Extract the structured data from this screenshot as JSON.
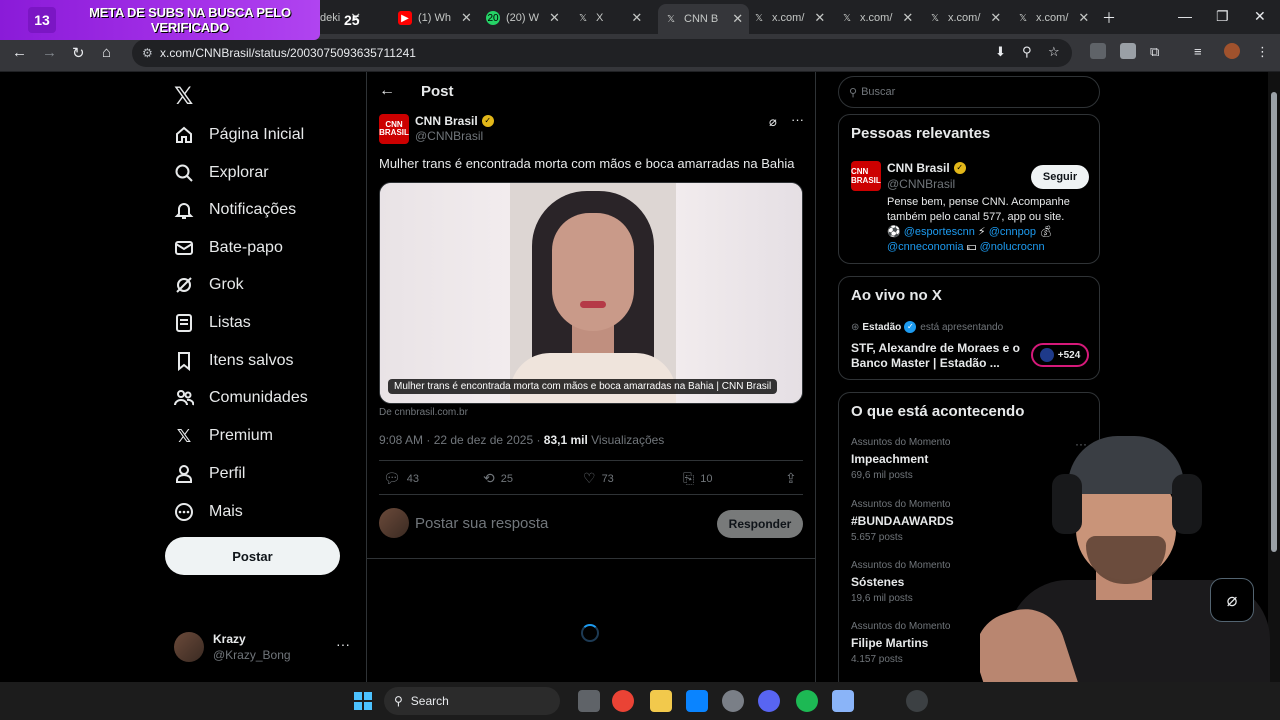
{
  "overlay": {
    "count": "13",
    "text": "META DE SUBS NA BUSCA PELO VERIFICADO",
    "badge": "25"
  },
  "tabs": [
    {
      "label": "deki"
    },
    {
      "label": "(1) Wh"
    },
    {
      "label": "(20) W"
    },
    {
      "label": "X"
    },
    {
      "label": "CNN B"
    },
    {
      "label": "x.com/"
    },
    {
      "label": "x.com/"
    },
    {
      "label": "x.com/"
    },
    {
      "label": "x.com/"
    }
  ],
  "browser": {
    "url": "x.com/CNNBrasil/status/2003075093635711241"
  },
  "sidebar": {
    "items": [
      {
        "label": "Página Inicial",
        "icon": "home-icon"
      },
      {
        "label": "Explorar",
        "icon": "search-icon"
      },
      {
        "label": "Notificações",
        "icon": "bell-icon"
      },
      {
        "label": "Bate-papo",
        "icon": "mail-icon"
      },
      {
        "label": "Grok",
        "icon": "grok-icon"
      },
      {
        "label": "Listas",
        "icon": "list-icon"
      },
      {
        "label": "Itens salvos",
        "icon": "bookmark-icon"
      },
      {
        "label": "Comunidades",
        "icon": "people-icon"
      },
      {
        "label": "Premium",
        "icon": "x-icon"
      },
      {
        "label": "Perfil",
        "icon": "person-icon"
      },
      {
        "label": "Mais",
        "icon": "more-circle-icon"
      }
    ],
    "post_label": "Postar",
    "account": {
      "name": "Krazy",
      "handle": "@Krazy_Bong"
    }
  },
  "post": {
    "header": "Post",
    "author": "CNN Brasil",
    "handle": "@CNNBrasil",
    "avatar_text": "CNN BRASIL",
    "text": "Mulher trans é encontrada morta com mãos e boca amarradas na Bahia",
    "caption": "Mulher trans é encontrada morta com mãos e boca amarradas na Bahia | CNN Brasil",
    "source": "De cnnbrasil.com.br",
    "time": "9:08 AM · 22 de dez de 2025 · ",
    "views": "83,1 mil",
    "views_label": " Visualizações",
    "replies": "43",
    "reposts": "25",
    "likes": "73",
    "bookmarks": "10",
    "reply_placeholder": "Postar sua resposta",
    "reply_label": "Responder"
  },
  "right": {
    "search_placeholder": "Buscar",
    "relevant": {
      "title": "Pessoas relevantes",
      "name": "CNN Brasil",
      "handle": "@CNNBrasil",
      "follow": "Seguir",
      "bio_text": "Pense bem, pense CNN. Acompanhe também pelo canal 577, app ou site.",
      "links": [
        "@esportescnn",
        "@cnnpop",
        "@cnneconomia",
        "@nolucrocnn"
      ]
    },
    "live": {
      "title": "Ao vivo no X",
      "host": "Estadão",
      "presenting": "está apresentando",
      "stream_title": "STF, Alexandre de Moraes e o Banco Master | Estadão ...",
      "badge": "+524"
    },
    "trends": {
      "title": "O que está acontecendo",
      "items": [
        {
          "category": "Assuntos do Momento",
          "name": "Impeachment",
          "count": "69,6 mil posts"
        },
        {
          "category": "Assuntos do Momento",
          "name": "#BUNDAAWARDS",
          "count": "5.657 posts"
        },
        {
          "category": "Assuntos do Momento",
          "name": "Sóstenes",
          "count": "19,6 mil posts"
        },
        {
          "category": "Assuntos do Momento",
          "name": "Filipe Martins",
          "count": "4.157 posts"
        }
      ]
    }
  },
  "taskbar": {
    "search_label": "Search"
  }
}
